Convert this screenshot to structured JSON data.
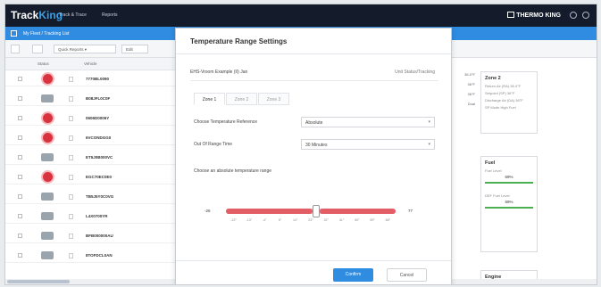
{
  "header": {
    "logo_main": "Track",
    "logo_accent": "King",
    "nav": [
      "Track & Trace",
      "Reports"
    ],
    "brand": "THERMO KING"
  },
  "breadcrumb": "My Fleet / Tracking List",
  "toolbar": {
    "quick_reports": "Quick Reports",
    "filter": "Edit"
  },
  "list": {
    "headers": [
      "Status",
      "Vehicle"
    ],
    "rows": [
      {
        "id": "7770BL0090",
        "alarm": true
      },
      {
        "id": "B08JFL0C0F",
        "alarm": false
      },
      {
        "id": "0606D0006Y",
        "alarm": true
      },
      {
        "id": "6VCONDGG0",
        "alarm": true
      },
      {
        "id": "ET5J0B000VC",
        "alarm": false
      },
      {
        "id": "EGC70EC0E0",
        "alarm": true
      },
      {
        "id": "TB5J5Y0C0VG",
        "alarm": false
      },
      {
        "id": "L4X0700YR",
        "alarm": false
      },
      {
        "id": "BFB000000AU",
        "alarm": false
      },
      {
        "id": "8TOFDCL0AN",
        "alarm": false
      }
    ]
  },
  "middle_values": [
    "36.0°F",
    "36°F",
    "36°F",
    "Dual"
  ],
  "right_panels": {
    "zone_title": "Zone 2",
    "zone_rows": [
      "Return Air (RA)   36.4°F",
      "Setpoint (SP)   36°F",
      "Discharge Air (DA)   36°F",
      "SP Mode   High Fuel"
    ],
    "fuel_title": "Fuel",
    "fuel_rows": [
      "Fuel Level",
      "69%",
      "DEF Fuel Level",
      "69%"
    ],
    "engine_title": "Engine"
  },
  "modal": {
    "title": "Temperature Range Settings",
    "vehicle_label": "EHS-Vroom Example (II) Jan",
    "status_link": "Unit Status/Tracking",
    "tabs": [
      "Zone 1",
      "Zone 2",
      "Zone 3"
    ],
    "active_tab": 0,
    "fields": [
      {
        "label": "Choose Temperature Reference",
        "value": "Absolute"
      },
      {
        "label": "Out Of Range Time",
        "value": "30 Minutes"
      }
    ],
    "range_label": "Choose an absolute temperature range",
    "slider": {
      "min_label": "-26",
      "max_label": "77",
      "ticks": [
        "-22°",
        "-13°",
        "-4°",
        "5°",
        "14°",
        "23°",
        "32°",
        "41°",
        "50°",
        "59°",
        "68°"
      ],
      "low_fraction": 0.0,
      "knob_fraction": 0.52,
      "high_fraction": 1.0
    },
    "confirm": "Confirm",
    "cancel": "Cancel"
  },
  "colors": {
    "topbar": "#141c2b",
    "accent": "#2f8ce0",
    "alarm": "#d9333f",
    "range": "#e25d66"
  }
}
